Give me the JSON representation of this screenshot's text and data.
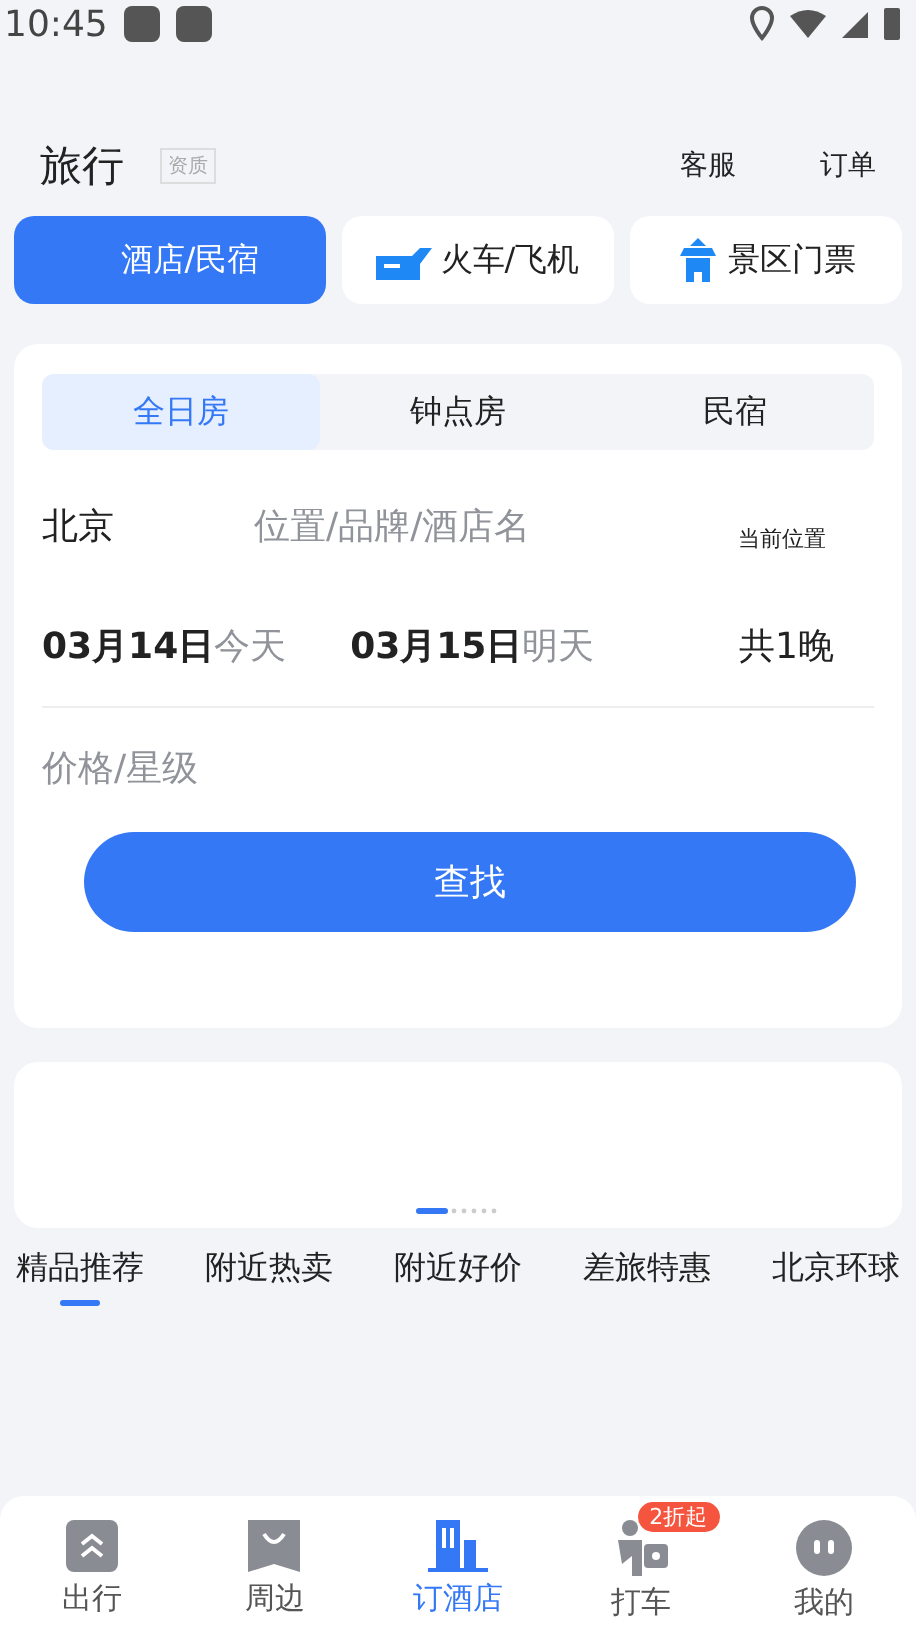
{
  "status_bar": {
    "time": "10:45"
  },
  "header": {
    "title": "旅行",
    "tag": "资质",
    "actions": [
      "客服",
      "订单"
    ]
  },
  "categories": [
    {
      "label": "酒店/民宿",
      "selected": true
    },
    {
      "label": "火车/飞机",
      "selected": false,
      "kind": "transport"
    },
    {
      "label": "景区门票",
      "selected": false,
      "kind": "scenic"
    }
  ],
  "room_tabs": [
    {
      "label": "全日房",
      "selected": true
    },
    {
      "label": "钟点房",
      "selected": false
    },
    {
      "label": "民宿",
      "selected": false
    }
  ],
  "search": {
    "city": "北京",
    "placeholder": "位置/品牌/酒店名",
    "location_link": "当前位置"
  },
  "dates": {
    "check_in": "03月14日",
    "check_in_note": "今天",
    "check_out": "03月15日",
    "check_out_note": "明天",
    "nights": "共1晚"
  },
  "price": {
    "placeholder": "价格/星级"
  },
  "search_button": "查找",
  "feed_tabs": [
    {
      "label": "精品推荐",
      "selected": true
    },
    {
      "label": "附近热卖",
      "selected": false
    },
    {
      "label": "附近好价",
      "selected": false
    },
    {
      "label": "差旅特惠",
      "selected": false
    },
    {
      "label": "北京环球",
      "selected": false
    }
  ],
  "bottom_nav": [
    {
      "label": "出行",
      "selected": false,
      "kind": "travel"
    },
    {
      "label": "周边",
      "selected": false,
      "kind": "nearby"
    },
    {
      "label": "订酒店",
      "selected": true,
      "kind": "hotel"
    },
    {
      "label": "打车",
      "selected": false,
      "kind": "taxi",
      "badge": "2折起"
    },
    {
      "label": "我的",
      "selected": false,
      "kind": "me"
    }
  ]
}
